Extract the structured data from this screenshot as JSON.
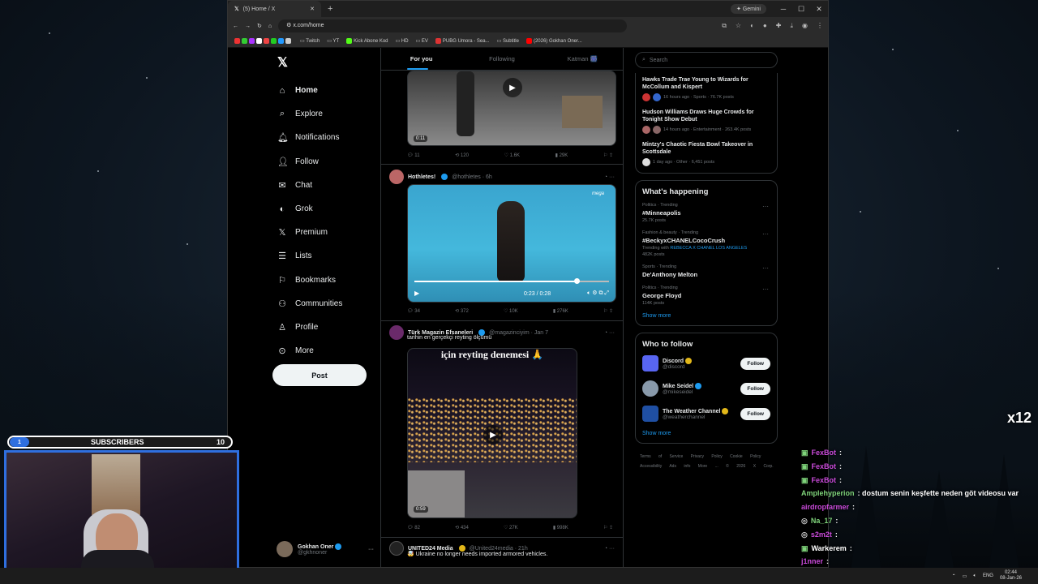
{
  "browser": {
    "tab_title": "(5) Home / X",
    "gemini_label": "Gemini",
    "url": "x.com/home",
    "bookmarks": [
      "Twitch",
      "YT",
      "Kick Abone Kod",
      "HD",
      "EV",
      "PUBG Umora - Sea...",
      "Subtitle",
      "(2026) Gokhan Oner..."
    ]
  },
  "nav": {
    "items": [
      "Home",
      "Explore",
      "Notifications",
      "Follow",
      "Chat",
      "Grok",
      "Premium",
      "Lists",
      "Bookmarks",
      "Communities",
      "Profile",
      "More"
    ],
    "post_label": "Post",
    "profile_name": "Gokhan Oner",
    "profile_handle": "@gkhnoner"
  },
  "feed": {
    "tabs": [
      "For you",
      "Following",
      "Katman 🎆"
    ],
    "tweet0": {
      "video_time": "0:11",
      "replies": "11",
      "reposts": "120",
      "likes": "1.6K",
      "views": "29K"
    },
    "tweet1": {
      "name": "Hothletes!",
      "handle": "@hothletes · 6h",
      "watermark": "mega",
      "video_time": "0:23 / 0:28",
      "replies": "34",
      "reposts": "372",
      "likes": "10K",
      "views": "276K"
    },
    "tweet2": {
      "name": "Türk Magazin Efsaneleri",
      "handle": "@magazinciyim · Jan 7",
      "text": "tarihin en gerçekçi reyting ölçümü",
      "overlay_text": "için reyting denemesi 🙏",
      "video_time": "0:59",
      "replies": "82",
      "reposts": "434",
      "likes": "27K",
      "views": "998K"
    },
    "tweet3": {
      "name": "UNITED24 Media",
      "handle": "@United24media · 21h",
      "text": "🤯 Ukraine no longer needs imported armored vehicles."
    }
  },
  "right": {
    "search_placeholder": "Search",
    "news": [
      {
        "title": "Hawks Trade Trae Young to Wizards for McCollum and Kispert",
        "meta": "16 hours ago · Sports · 76.7K posts"
      },
      {
        "title": "Hudson Williams Draws Huge Crowds for Tonight Show Debut",
        "meta": "14 hours ago · Entertainment · 263.4K posts"
      },
      {
        "title": "Mintzy's Chaotic Fiesta Bowl Takeover in Scottsdale",
        "meta": "1 day ago · Other · 6,451 posts"
      }
    ],
    "happening_title": "What's happening",
    "trends": [
      {
        "cat": "Politics · Trending",
        "name": "#Minneapolis",
        "posts": "25.7K posts"
      },
      {
        "cat": "Fashion & beauty · Trending",
        "name": "#BeckyxCHANELCocoCrush",
        "posts": "482K posts",
        "with": "Trending with",
        "with_link": "REBECCA X CHANEL LOS ANGELES"
      },
      {
        "cat": "Sports · Trending",
        "name": "De'Anthony Melton",
        "posts": ""
      },
      {
        "cat": "Politics · Trending",
        "name": "George Floyd",
        "posts": "114K posts"
      }
    ],
    "show_more": "Show more",
    "wtf_title": "Who to follow",
    "wtf": [
      {
        "name": "Discord",
        "handle": "@discord",
        "color": "#5865f2"
      },
      {
        "name": "Mike Seidel",
        "handle": "@mikeseidel",
        "color": "#8899aa"
      },
      {
        "name": "The Weather Channel",
        "handle": "@weatherchannel",
        "color": "#1f4fa3"
      }
    ],
    "follow_label": "Follow",
    "footer": "Terms of Service  Privacy Policy  Cookie Policy  Accessibility  Ads info  More ...  © 2026 X Corp."
  },
  "overlay": {
    "subs_current": "1",
    "subs_label": "SUBSCRIBERS",
    "subs_goal": "10",
    "multiplier": "x12",
    "chat": [
      {
        "user": "FexBot",
        "msg": ":",
        "color": "#c94ad9"
      },
      {
        "user": "FexBot",
        "msg": ":",
        "color": "#c94ad9"
      },
      {
        "user": "FexBot",
        "msg": ":",
        "color": "#c94ad9"
      },
      {
        "user": "Amplehyperion",
        "msg": ": dostum senin keşfette neden göt videosu var",
        "color": "#7fd37a"
      },
      {
        "user": "airdropfarmer",
        "msg": ":",
        "color": "#c94ad9"
      },
      {
        "user": "Na_17",
        "msg": ":",
        "color": "#7fd37a"
      },
      {
        "user": "s2m2t",
        "msg": ":",
        "color": "#c94ad9"
      },
      {
        "user": "Warkerem",
        "msg": ":",
        "color": "#fff"
      },
      {
        "user": "j1nner",
        "msg": ":",
        "color": "#c94ad9"
      }
    ]
  },
  "taskbar": {
    "lang": "ENG",
    "time": "02:44",
    "date": "08-Jan-26"
  }
}
